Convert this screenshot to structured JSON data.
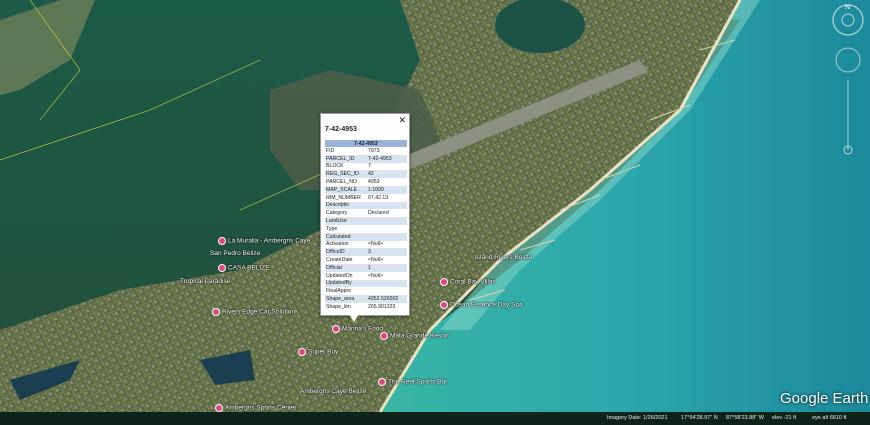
{
  "popup": {
    "title": "7-42-4953",
    "header": "7-42-4953",
    "close": "✕",
    "rows": [
      {
        "k": "FID",
        "v": "7973"
      },
      {
        "k": "PARCEL_ID",
        "v": "7-42-4953"
      },
      {
        "k": "BLOCK",
        "v": "7"
      },
      {
        "k": "REG_SEC_ID",
        "v": "42"
      },
      {
        "k": "PARCEL_NO",
        "v": "4953"
      },
      {
        "k": "MAP_SCALE",
        "v": "1:1000"
      },
      {
        "k": "RIM_NUMBER",
        "v": "07.42.13"
      },
      {
        "k": "Descriptio",
        "v": ""
      },
      {
        "k": "Category",
        "v": "Declared"
      },
      {
        "k": "LandUse",
        "v": ""
      },
      {
        "k": "Type",
        "v": ""
      },
      {
        "k": "Calculated",
        "v": ""
      },
      {
        "k": "Activation",
        "v": "<Null>"
      },
      {
        "k": "OfficeID",
        "v": "3"
      },
      {
        "k": "CreateDate",
        "v": "<Null>"
      },
      {
        "k": "Official",
        "v": "1"
      },
      {
        "k": "UpdatedOn",
        "v": "<Null>"
      },
      {
        "k": "UpdatedBy",
        "v": ""
      },
      {
        "k": "FinalAppro",
        "v": ""
      },
      {
        "k": "Shape_area",
        "v": "4352.526502"
      },
      {
        "k": "Shape_len",
        "v": "265.901333"
      }
    ]
  },
  "places": [
    {
      "label": "La Muralla - Ambergris Caye"
    },
    {
      "label": "San Pedro Belize"
    },
    {
      "label": "CASA BELIZE"
    },
    {
      "label": "Tropical Paradise"
    },
    {
      "label": "Rivers Edge Car Solutions"
    },
    {
      "label": "Island Rivers Belize"
    },
    {
      "label": "Coral Bay Villas"
    },
    {
      "label": "Ocean Essence Day Spa"
    },
    {
      "label": "Marina's Food"
    },
    {
      "label": "Mata Grande Resort"
    },
    {
      "label": "Super Buy"
    },
    {
      "label": "The Reef Sports Bar"
    },
    {
      "label": "Ambergris Sports Center"
    },
    {
      "label": "Ambergris Caye Belize"
    }
  ],
  "status": {
    "imagery_date": "Imagery Date: 1/26/2021",
    "lat": "17°54'28.97\" N",
    "lon": "87°58'23.88\" W",
    "elev": "elev   -21 ft",
    "eye_alt": "eye alt  6810 ft"
  },
  "logo": "Google Earth",
  "colors": {
    "sea": "#2fb8b0",
    "lagoon": "#1e5e4a",
    "land": "#6b7a55",
    "parcel": "#d8d83a"
  }
}
